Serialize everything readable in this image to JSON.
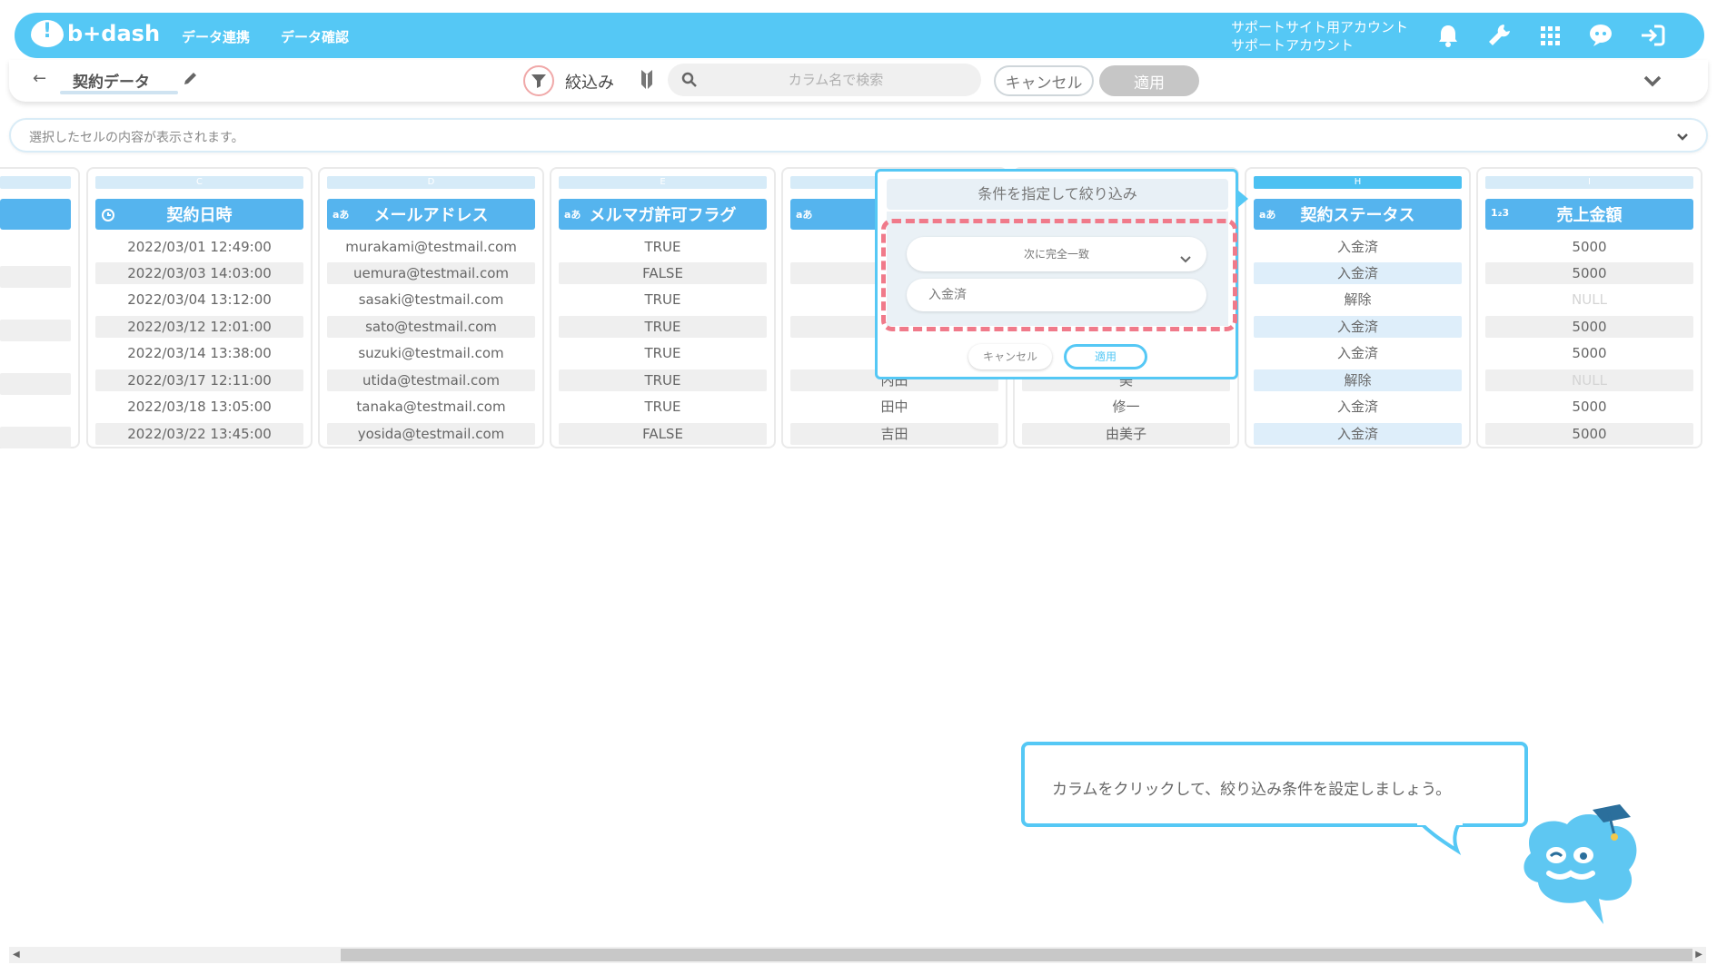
{
  "header": {
    "logo_text": "b+dash",
    "nav": [
      "データ連携",
      "データ確認"
    ],
    "account_line1": "サポートサイト用アカウント",
    "account_line2": "サポートアカウント",
    "icons": [
      "bell-icon",
      "wrench-icon",
      "grid-icon",
      "chat-icon",
      "logout-icon"
    ]
  },
  "toolbar": {
    "back": "←",
    "dataset_name": "契約データ",
    "filter_label": "絞込み",
    "search_placeholder": "カラム名で検索",
    "cancel": "キャンセル",
    "apply": "適用"
  },
  "cellbar": {
    "text": "選択したセルの内容が表示されます。"
  },
  "columns": [
    {
      "letter": "C",
      "type": "clock",
      "name": "契約日時",
      "cells": [
        "2022/03/01 12:49:00",
        "2022/03/03 14:03:00",
        "2022/03/04 13:12:00",
        "2022/03/12 12:01:00",
        "2022/03/14 13:38:00",
        "2022/03/17 12:11:00",
        "2022/03/18 13:05:00",
        "2022/03/22 13:45:00"
      ]
    },
    {
      "letter": "D",
      "type": "aあ",
      "name": "メールアドレス",
      "cells": [
        "murakami@testmail.com",
        "uemura@testmail.com",
        "sasaki@testmail.com",
        "sato@testmail.com",
        "suzuki@testmail.com",
        "utida@testmail.com",
        "tanaka@testmail.com",
        "yosida@testmail.com"
      ]
    },
    {
      "letter": "E",
      "type": "aあ",
      "name": "メルマガ許可フラグ",
      "cells": [
        "TRUE",
        "FALSE",
        "TRUE",
        "TRUE",
        "TRUE",
        "TRUE",
        "TRUE",
        "FALSE"
      ]
    },
    {
      "letter": "",
      "type": "aあ",
      "name": "",
      "cells": [
        "",
        "",
        "",
        "",
        "",
        "内田",
        "田中",
        "吉田"
      ]
    },
    {
      "letter": "",
      "type": "",
      "name": "",
      "cells": [
        "",
        "",
        "",
        "",
        "",
        "美",
        "修一",
        "由美子"
      ]
    },
    {
      "letter": "H",
      "type": "aあ",
      "name": "契約ステータス",
      "cells": [
        "入金済",
        "入金済",
        "解除",
        "入金済",
        "入金済",
        "解除",
        "入金済",
        "入金済"
      ]
    },
    {
      "letter": "I",
      "type": "1₂3",
      "name": "売上金額",
      "cells": [
        "5000",
        "5000",
        "NULL",
        "5000",
        "5000",
        "NULL",
        "5000",
        "5000"
      ]
    }
  ],
  "popup": {
    "title": "条件を指定して絞り込み",
    "condition": "次に完全一致",
    "value": "入金済",
    "cancel": "キャンセル",
    "apply": "適用"
  },
  "guide": {
    "text": "カラムをクリックして、絞り込み条件を設定しましょう。"
  },
  "colors": {
    "brand": "#55c8f5",
    "header_cell": "#55b4ee",
    "highlight_dash": "#f07a8a"
  }
}
